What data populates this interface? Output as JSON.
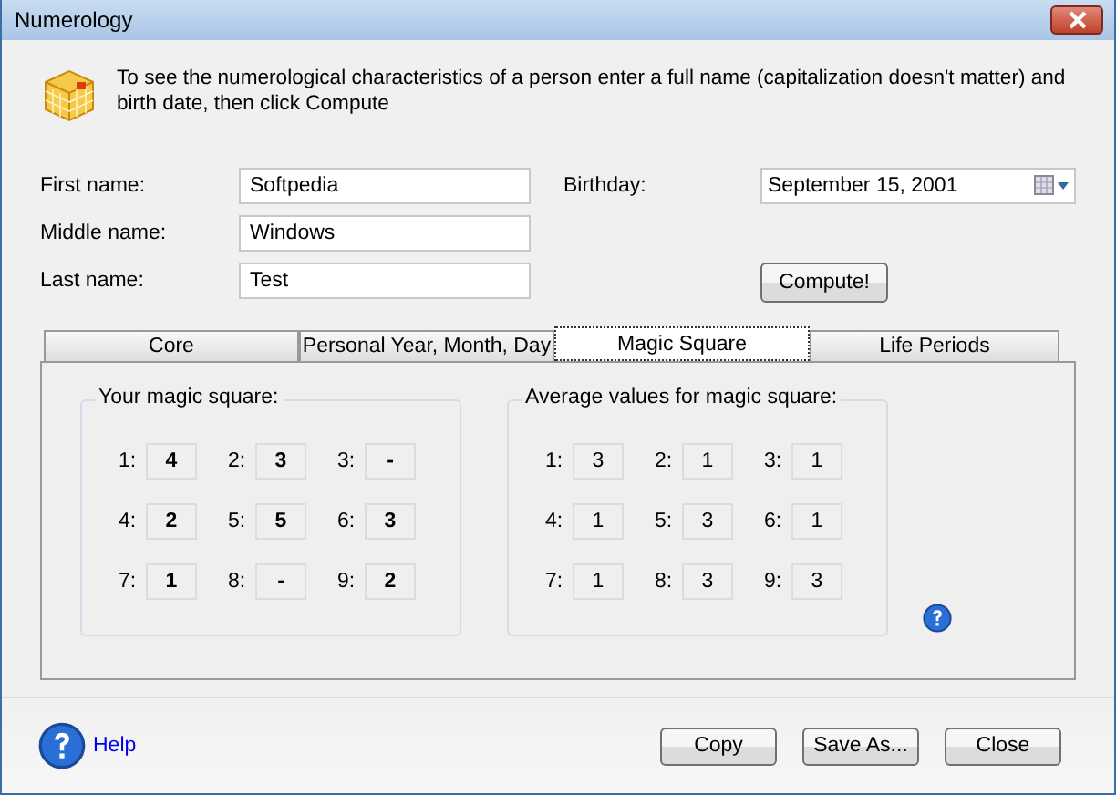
{
  "window": {
    "title": "Numerology"
  },
  "intro": "To see the numerological characteristics of a person enter a full name (capitalization doesn't matter) and birth date, then click Compute",
  "fields": [
    {
      "label": "First name:",
      "value": "Softpedia"
    },
    {
      "label": "Middle name:",
      "value": "Windows"
    },
    {
      "label": "Last name:",
      "value": "Test"
    }
  ],
  "birthday": {
    "label": "Birthday:",
    "value": "September 15, 2001"
  },
  "compute_button": "Compute!",
  "tabs": [
    {
      "label": "Core",
      "selected": false
    },
    {
      "label": "Personal Year, Month, Day",
      "selected": false
    },
    {
      "label": "Magic Square",
      "selected": true
    },
    {
      "label": "Life Periods",
      "selected": false
    }
  ],
  "groups": [
    {
      "title": "Your magic square:",
      "bold": true,
      "cells": [
        {
          "label": "1:",
          "value": "4"
        },
        {
          "label": "2:",
          "value": "3"
        },
        {
          "label": "3:",
          "value": "-"
        },
        {
          "label": "4:",
          "value": "2"
        },
        {
          "label": "5:",
          "value": "5"
        },
        {
          "label": "6:",
          "value": "3"
        },
        {
          "label": "7:",
          "value": "1"
        },
        {
          "label": "8:",
          "value": "-"
        },
        {
          "label": "9:",
          "value": "2"
        }
      ]
    },
    {
      "title": "Average values for magic square:",
      "bold": false,
      "cells": [
        {
          "label": "1:",
          "value": "3"
        },
        {
          "label": "2:",
          "value": "1"
        },
        {
          "label": "3:",
          "value": "1"
        },
        {
          "label": "4:",
          "value": "1"
        },
        {
          "label": "5:",
          "value": "3"
        },
        {
          "label": "6:",
          "value": "1"
        },
        {
          "label": "7:",
          "value": "1"
        },
        {
          "label": "8:",
          "value": "3"
        },
        {
          "label": "9:",
          "value": "3"
        }
      ]
    }
  ],
  "help_link": "Help",
  "buttons": [
    "Copy",
    "Save As...",
    "Close"
  ]
}
